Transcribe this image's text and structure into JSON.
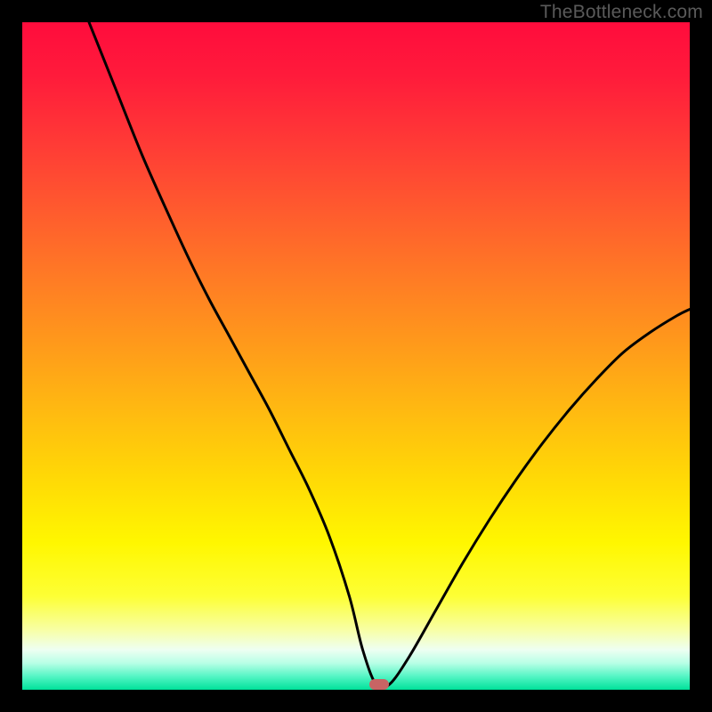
{
  "watermark": "TheBottleneck.com",
  "colors": {
    "frame": "#000000",
    "curve_stroke": "#000000",
    "marker_fill": "#c86464",
    "watermark_text": "#5a5a5a"
  },
  "chart_data": {
    "type": "line",
    "title": "",
    "xlabel": "",
    "ylabel": "",
    "xlim": [
      0,
      100
    ],
    "ylim": [
      0,
      100
    ],
    "grid": false,
    "curve_note": "y ≈ |x − 53| shaped valley; nonlinear flanks; left side reaches ~100 at x≈10, right side reaches ~57 at x=100; flat minimum ≈0 around x 50–55",
    "x": [
      10,
      14,
      18,
      22,
      25,
      28,
      31,
      34,
      37,
      40,
      43,
      46,
      49,
      51,
      53,
      55,
      58,
      62,
      66,
      70,
      74,
      78,
      82,
      86,
      90,
      94,
      98,
      100
    ],
    "y": [
      100,
      90,
      80,
      71,
      64.5,
      58.5,
      53,
      47.5,
      42,
      36,
      30,
      23,
      14,
      6,
      0.8,
      0.8,
      5,
      12,
      19,
      25.5,
      31.5,
      37,
      42,
      46.5,
      50.5,
      53.5,
      56,
      57
    ],
    "marker": {
      "x": 53.5,
      "y": 0.8
    },
    "background_gradient_stops": [
      {
        "pos": 0,
        "color": "#ff0c3c"
      },
      {
        "pos": 18,
        "color": "#ff3a36"
      },
      {
        "pos": 38,
        "color": "#ff7a25"
      },
      {
        "pos": 58,
        "color": "#ffb911"
      },
      {
        "pos": 78,
        "color": "#fff700"
      },
      {
        "pos": 91,
        "color": "#f8ffa4"
      },
      {
        "pos": 96,
        "color": "#b8ffe6"
      },
      {
        "pos": 100,
        "color": "#00e29a"
      }
    ]
  }
}
